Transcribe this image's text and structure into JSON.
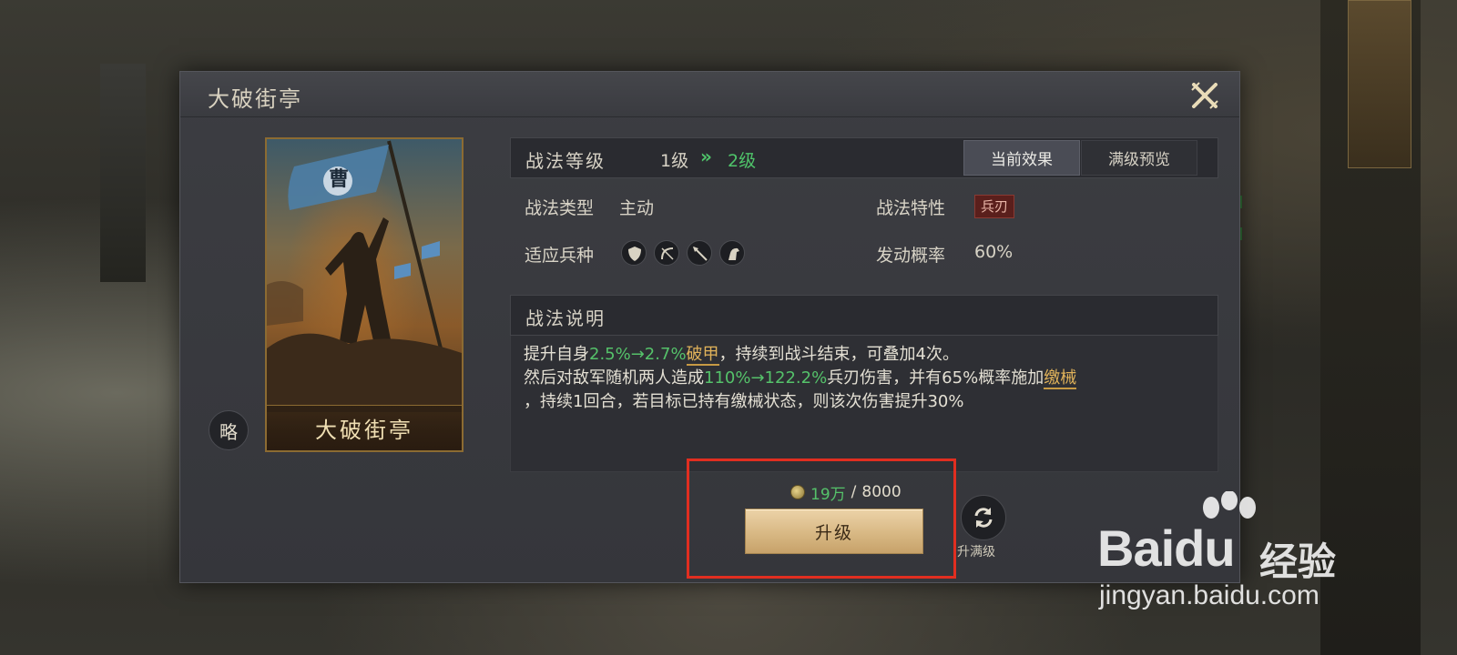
{
  "dialog": {
    "title": "大破街亭"
  },
  "card": {
    "name": "大破街亭",
    "flag_text": "曹",
    "faction_badge": "略"
  },
  "level": {
    "label": "战法等级",
    "from": "1级",
    "arrow": "»",
    "to": "2级"
  },
  "tabs": {
    "current": "当前效果",
    "max_preview": "满级预览"
  },
  "stats": {
    "type_label": "战法类型",
    "type_value": "主动",
    "trait_label": "战法特性",
    "trait_value": "兵刃",
    "troops_label": "适应兵种",
    "troop_icons": [
      "shield-icon",
      "bow-icon",
      "spear-icon",
      "horse-icon"
    ],
    "chance_label": "发动概率",
    "chance_value": "60%"
  },
  "description": {
    "title": "战法说明",
    "l1_a": "提升自身",
    "l1_b": "2.5%→2.7%",
    "l1_c": "破甲",
    "l1_d": "，持续到战斗结束，可叠加4次。",
    "l2_a": "然后对敌军随机两人造成",
    "l2_b": "110%→122.2%",
    "l2_c": "兵刃伤害，并有65%概率施加",
    "l2_d": "缴械",
    "l3": "，持续1回合，若目标已持有缴械状态，则该次伤害提升30%"
  },
  "cost": {
    "have": "19万",
    "sep": "/",
    "need": "8000"
  },
  "buttons": {
    "upgrade": "升级",
    "max_level": "升满级"
  },
  "watermark": {
    "logo": "Baidu",
    "cn": "经验",
    "url": "jingyan.baidu.com"
  },
  "colors": {
    "green_value": "#55c26a",
    "gold_keyword": "#e1b35a",
    "annotation_red": "#e12e20"
  }
}
